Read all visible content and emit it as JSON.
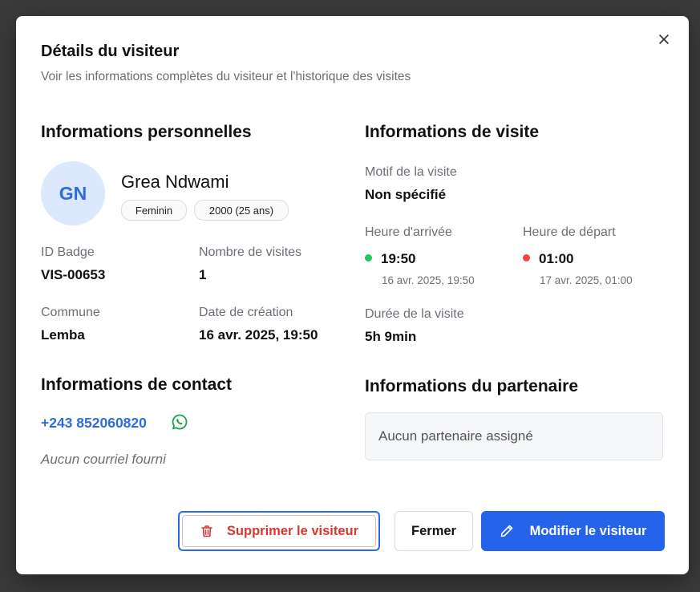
{
  "modal": {
    "title": "Détails du visiteur",
    "subtitle": "Voir les informations complètes du visiteur et l'historique des visites",
    "close_icon": "close-icon"
  },
  "personal": {
    "section_title": "Informations personnelles",
    "initials": "GN",
    "name": "Grea Ndwami",
    "gender": "Feminin",
    "birth": "2000 (25 ans)",
    "badge_label": "ID Badge",
    "badge_value": "VIS-00653",
    "visits_label": "Nombre de visites",
    "visits_value": "1",
    "commune_label": "Commune",
    "commune_value": "Lemba",
    "created_label": "Date de création",
    "created_value": "16 avr. 2025, 19:50"
  },
  "contact": {
    "section_title": "Informations de contact",
    "phone": "+243 852060820",
    "phone_icon": "whatsapp-icon",
    "email_placeholder": "Aucun courriel fourni"
  },
  "visit": {
    "section_title": "Informations de visite",
    "reason_label": "Motif de la visite",
    "reason_value": "Non spécifié",
    "arrival_label": "Heure d'arrivée",
    "arrival_time": "19:50",
    "arrival_full": "16 avr. 2025, 19:50",
    "arrival_color": "#22c55e",
    "departure_label": "Heure de départ",
    "departure_time": "01:00",
    "departure_full": "17 avr. 2025, 01:00",
    "departure_color": "#ef4444",
    "duration_label": "Durée de la visite",
    "duration_value": "5h 9min"
  },
  "partner": {
    "section_title": "Informations du partenaire",
    "empty_text": "Aucun partenaire assigné"
  },
  "actions": {
    "delete_label": "Supprimer le visiteur",
    "delete_icon": "trash-icon",
    "close_label": "Fermer",
    "edit_label": "Modifier le visiteur",
    "edit_icon": "pencil-icon",
    "accent": "#2563eb",
    "danger": "#d8372f"
  }
}
